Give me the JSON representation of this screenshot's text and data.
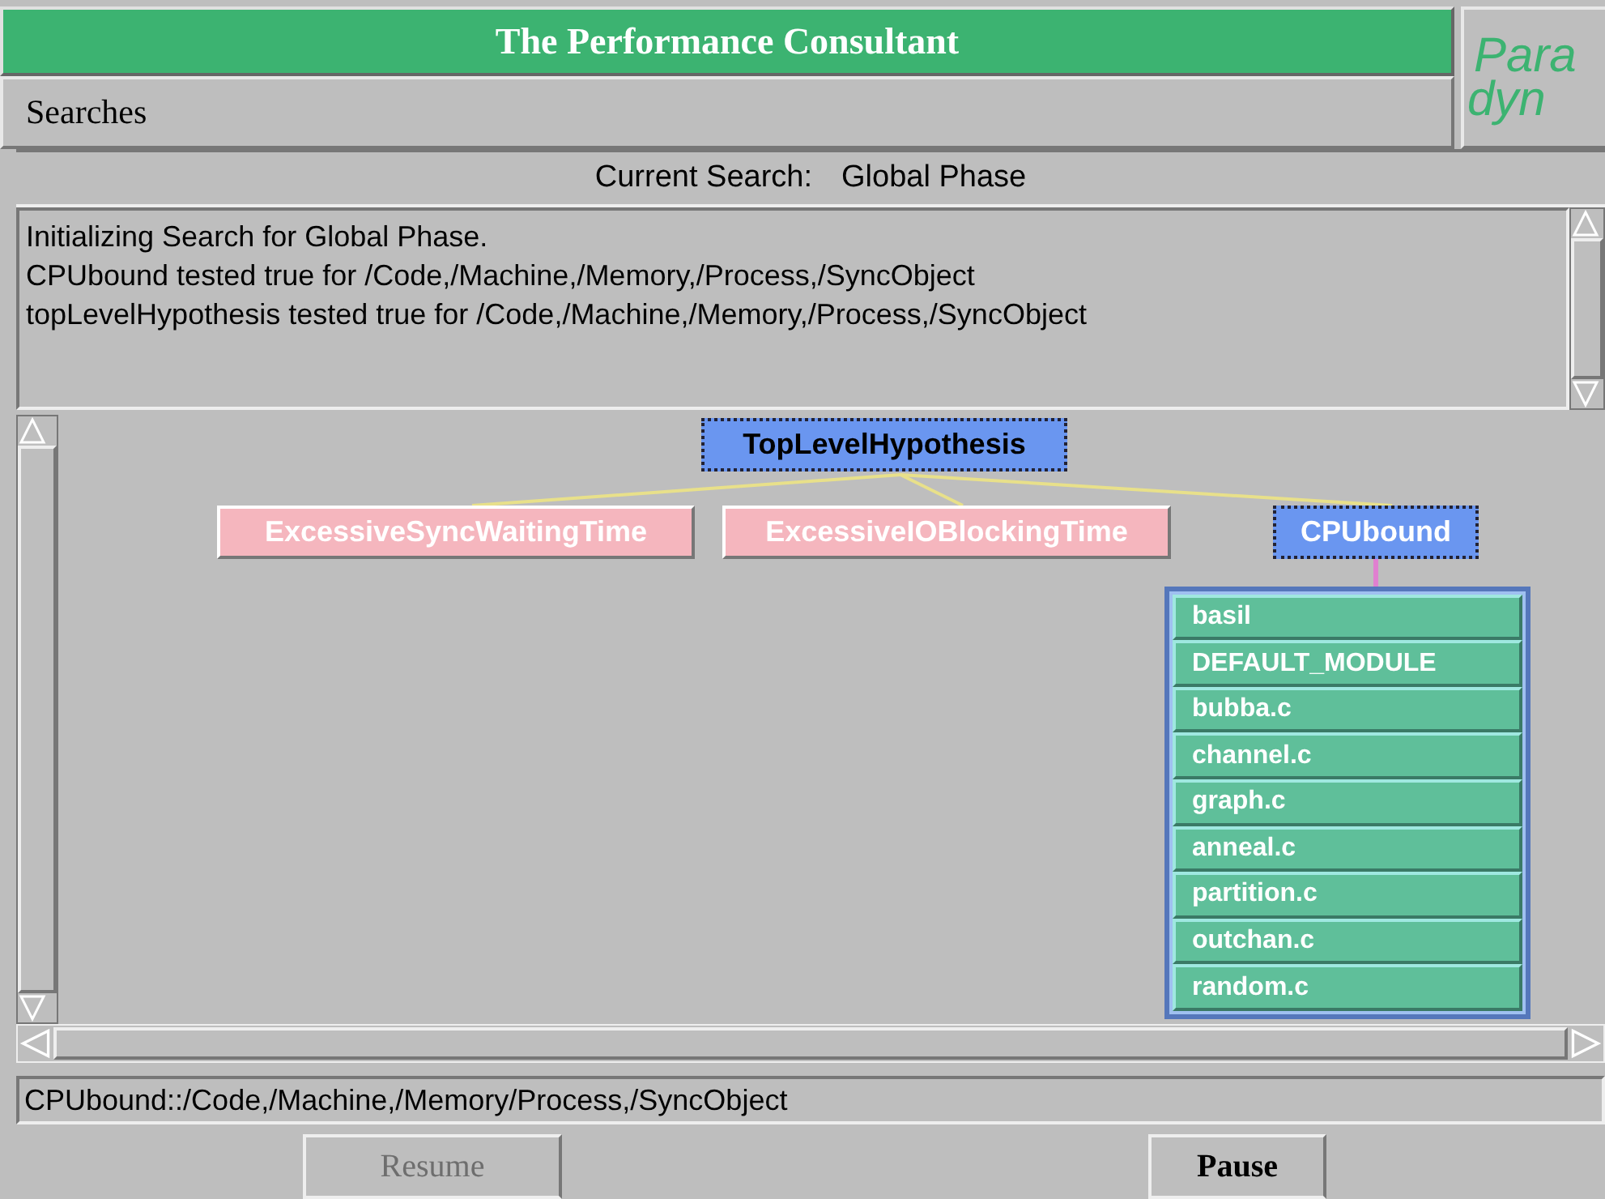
{
  "window": {
    "title": "The Performance Consultant"
  },
  "logo": {
    "top": "Para",
    "bottom": "dyn"
  },
  "menu": [
    "Searches"
  ],
  "current_search": {
    "label": "Current Search:",
    "value": "Global Phase"
  },
  "log": [
    "Initializing Search for Global Phase.",
    "CPUbound tested true for /Code,/Machine,/Memory,/Process,/SyncObject",
    "topLevelHypothesis tested true for /Code,/Machine,/Memory,/Process,/SyncObject"
  ],
  "tree": {
    "label": "TopLevelHypothesis",
    "color": "#6a96f0",
    "selected": true,
    "children": [
      {
        "label": "ExcessiveSyncWaitingTime",
        "color": "#f5b6be",
        "selected": false
      },
      {
        "label": "ExcessiveIOBlockingTime",
        "color": "#f5b6be",
        "selected": false
      },
      {
        "label": "CPUbound",
        "color": "#6a96f0",
        "selected": true,
        "children": [
          {
            "label": "basil",
            "color": "#5fbf9a"
          },
          {
            "label": "DEFAULT_MODULE",
            "color": "#5fbf9a"
          },
          {
            "label": "bubba.c",
            "color": "#5fbf9a"
          },
          {
            "label": "channel.c",
            "color": "#5fbf9a"
          },
          {
            "label": "graph.c",
            "color": "#5fbf9a"
          },
          {
            "label": "anneal.c",
            "color": "#5fbf9a"
          },
          {
            "label": "partition.c",
            "color": "#5fbf9a"
          },
          {
            "label": "outchan.c",
            "color": "#5fbf9a"
          },
          {
            "label": "random.c",
            "color": "#5fbf9a"
          }
        ]
      }
    ]
  },
  "status": "CPUbound::/Code,/Machine,/Memory/Process,/SyncObject",
  "buttons": [
    {
      "label": "Resume",
      "disabled": true
    },
    {
      "label": "Pause",
      "disabled": false
    }
  ]
}
